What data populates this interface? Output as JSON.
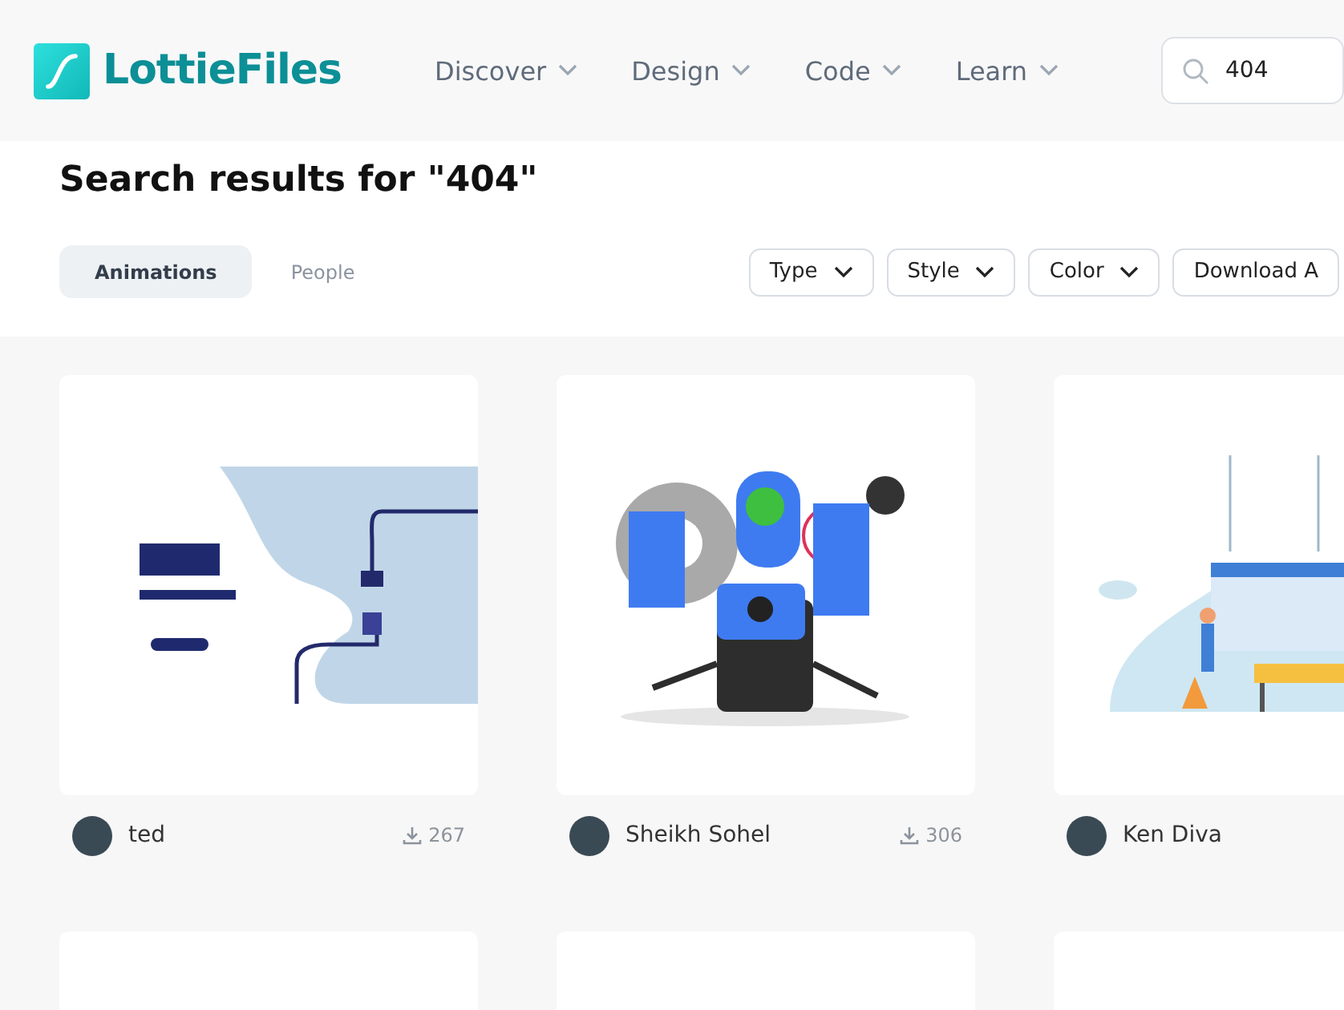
{
  "header": {
    "logo": "LottieFiles",
    "nav": [
      {
        "label": "Discover"
      },
      {
        "label": "Design"
      },
      {
        "label": "Code"
      },
      {
        "label": "Learn"
      }
    ],
    "search": {
      "value": "404"
    }
  },
  "title": "Search results for \"404\"",
  "tabs": [
    {
      "label": "Animations",
      "selected": true
    },
    {
      "label": "People",
      "selected": false
    }
  ],
  "filters": [
    {
      "label": "Type"
    },
    {
      "label": "Style"
    },
    {
      "label": "Color"
    },
    {
      "label": "Download A"
    }
  ],
  "results": [
    {
      "kind": "plug",
      "author": "ted",
      "downloads": "267"
    },
    {
      "kind": "robot",
      "author": "Sheikh Sohel",
      "downloads": "306"
    },
    {
      "kind": "construction",
      "author": "Ken Diva"
    }
  ]
}
